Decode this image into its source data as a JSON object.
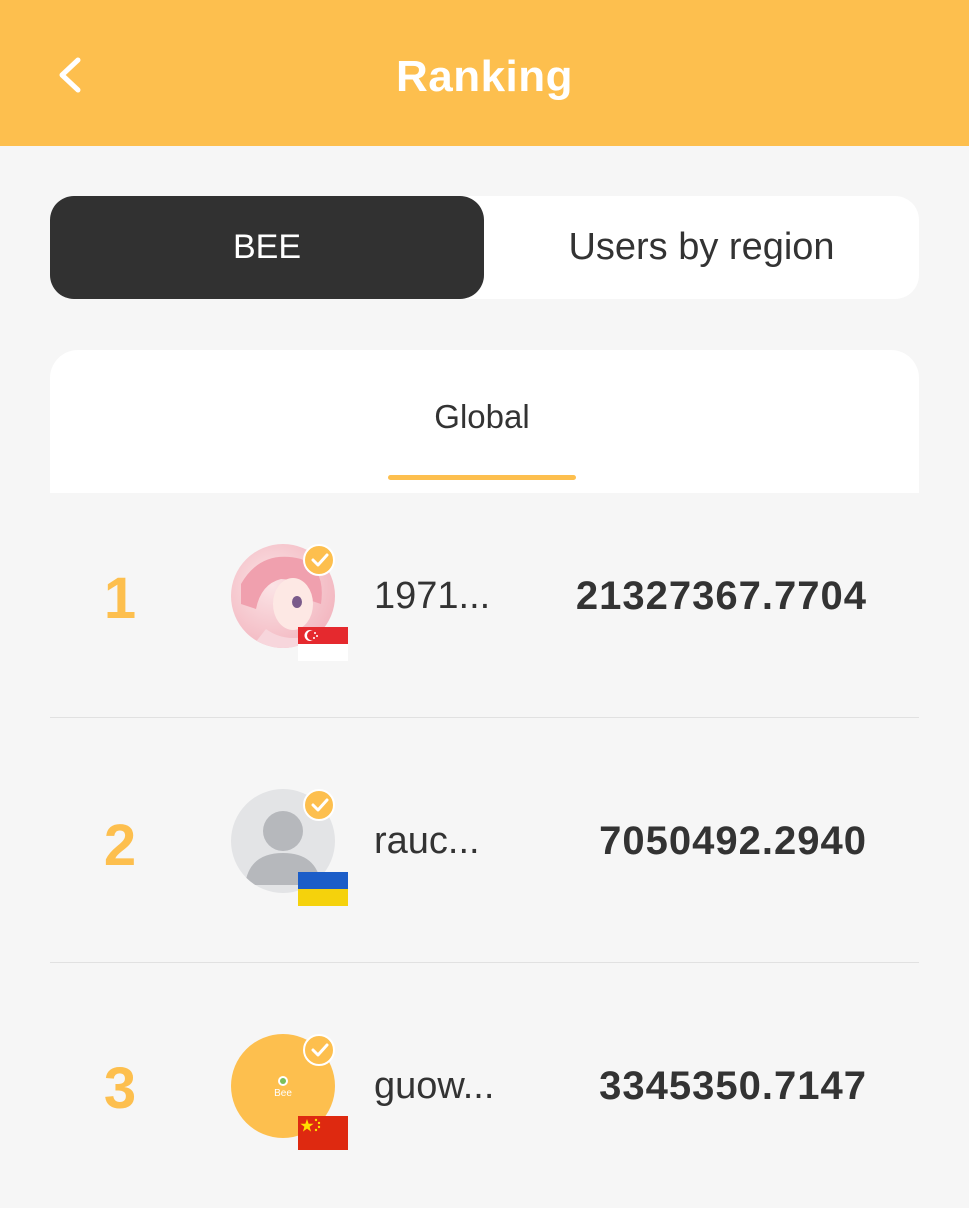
{
  "header": {
    "title": "Ranking",
    "back_icon": "chevron-left-icon",
    "color": "#fdbf4e"
  },
  "segments": {
    "active_label": "BEE",
    "inactive_label": "Users by region"
  },
  "tabs": {
    "global_label": "Global"
  },
  "ranking": [
    {
      "rank": "1",
      "username": "1971...",
      "score": "21327367.7704",
      "region_flag": "singapore-flag-icon",
      "avatar": "anime-avatar",
      "verified": true
    },
    {
      "rank": "2",
      "username": "rauc...",
      "score": "7050492.2940",
      "region_flag": "ukraine-flag-icon",
      "avatar": "default-user-avatar",
      "verified": true
    },
    {
      "rank": "3",
      "username": "guow...",
      "score": "3345350.7147",
      "region_flag": "china-flag-icon",
      "avatar": "bee-logo-avatar",
      "verified": true,
      "avatar_text": "Bee"
    }
  ]
}
